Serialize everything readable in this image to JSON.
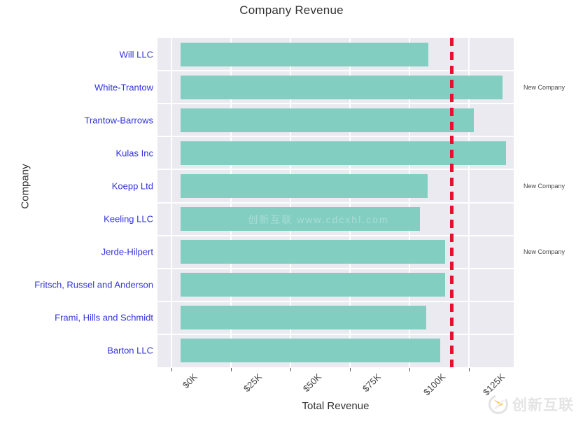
{
  "chart_data": {
    "type": "bar",
    "orientation": "horizontal",
    "title": "Company Revenue",
    "xlabel": "Total Revenue",
    "ylabel": "Company",
    "categories": [
      "Will LLC",
      "White-Trantow",
      "Trantow-Barrows",
      "Kulas Inc",
      "Koepp Ltd",
      "Keeling LLC",
      "Jerde-Hilpert",
      "Fritsch, Russel and Anderson",
      "Frami, Hills and Schmidt",
      "Barton LLC"
    ],
    "values": [
      108000,
      139000,
      127000,
      140500,
      107500,
      104500,
      115000,
      115000,
      107000,
      112800
    ],
    "xlim": [
      0,
      150000
    ],
    "xticks": [
      0,
      25000,
      50000,
      75000,
      100000,
      125000
    ],
    "xtick_labels": [
      "$0K",
      "$25K",
      "$50K",
      "$75K",
      "$100K",
      "$125K"
    ],
    "grid": true,
    "legend": null,
    "bar_color": "#82cec1",
    "plot_background": "#eaeaf0",
    "ytick_color": "#3333dd",
    "threshold": {
      "value": 117600,
      "label": "",
      "color": "#e8112d",
      "style": "dashed"
    },
    "annotations": [
      {
        "text": "New Company",
        "category": "White-Trantow"
      },
      {
        "text": "New Company",
        "category": "Koepp Ltd"
      },
      {
        "text": "New Company",
        "category": "Jerde-Hilpert"
      }
    ],
    "inner_watermark": "创新互联 www.cdcxhl.com"
  },
  "watermark": {
    "text": "创新互联",
    "mark": "cx-logo-icon"
  }
}
